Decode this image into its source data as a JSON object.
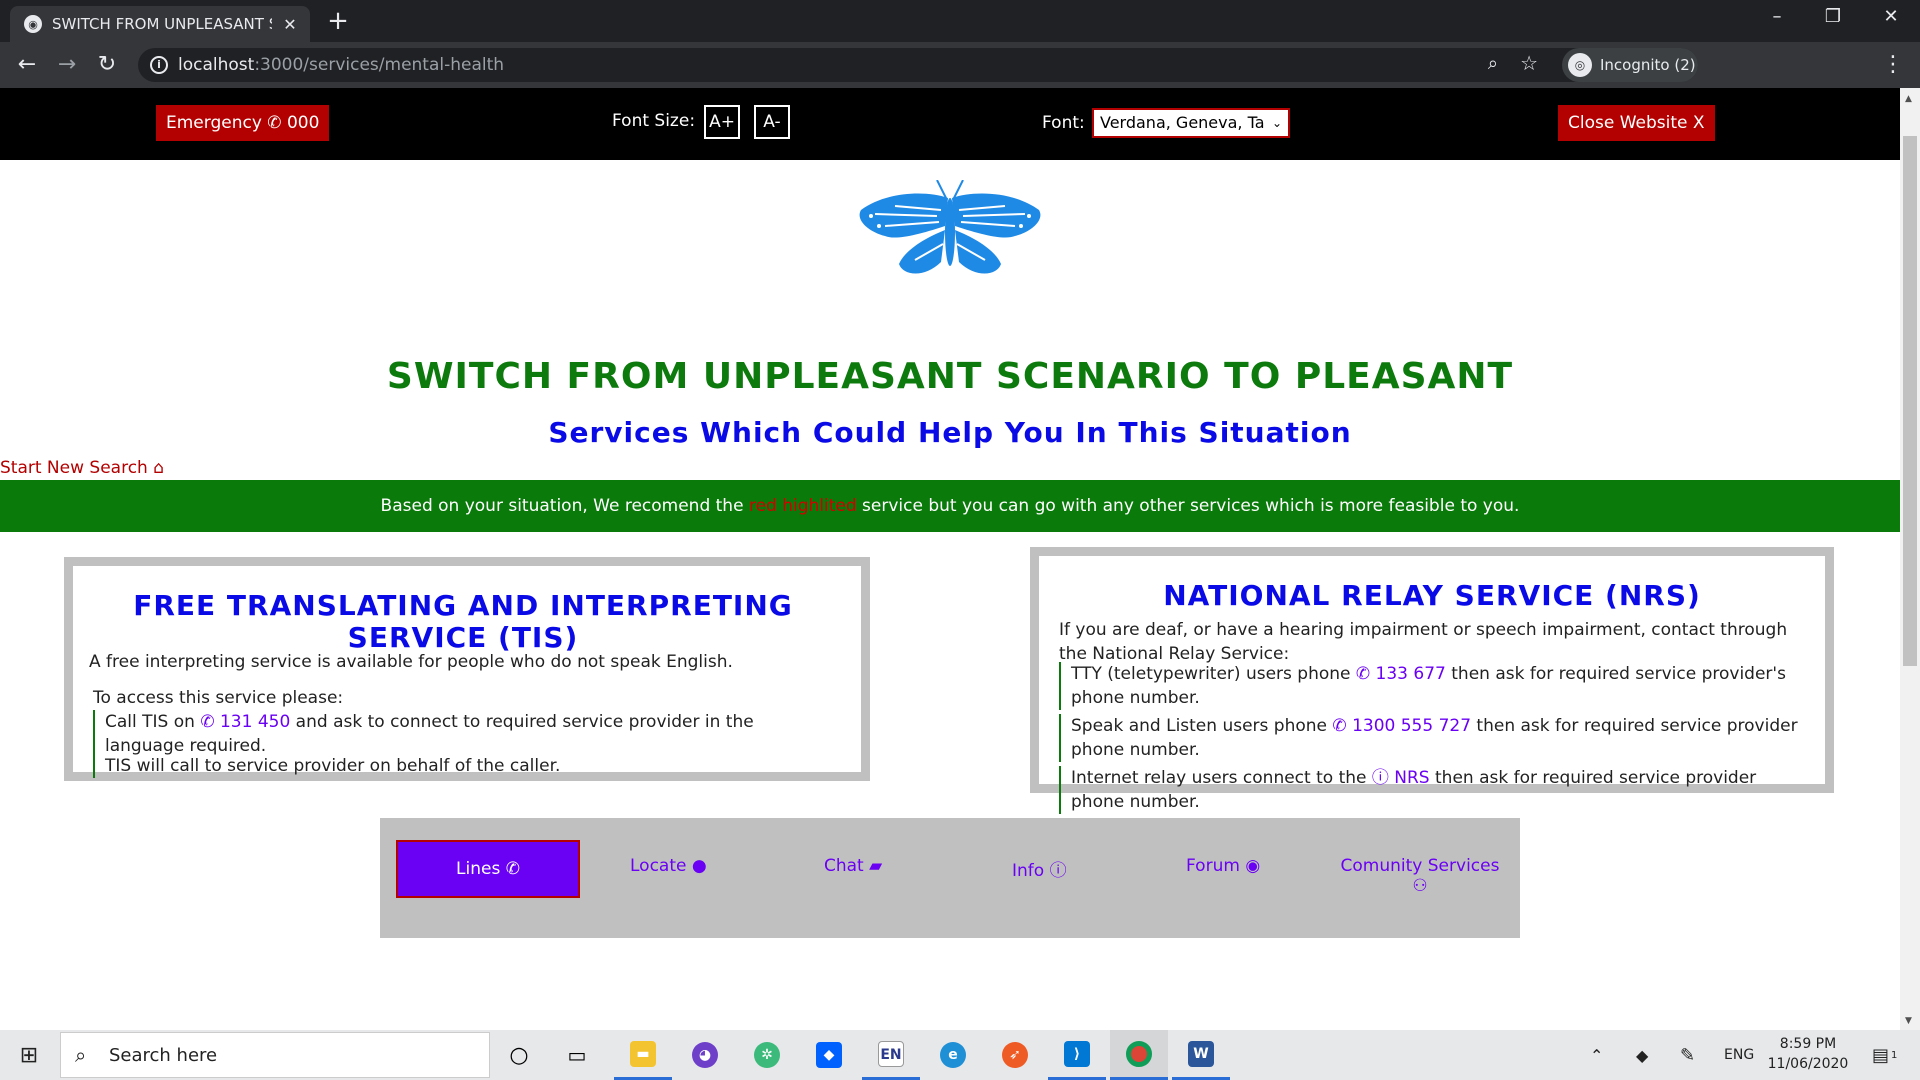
{
  "browser": {
    "tab_title": "SWITCH FROM UNPLEASANT SCENARIO TO PLEASANT",
    "url_host": "localhost",
    "url_path": ":3000/services/mental-health",
    "profile_label": "Incognito (2)"
  },
  "a11y": {
    "emergency_label": "Emergency",
    "emergency_number": "000",
    "font_size_label": "Font Size:",
    "font_increase": "A+",
    "font_decrease": "A-",
    "font_label": "Font:",
    "font_value": "Verdana, Geneva, Ta",
    "close_label": "Close Website X"
  },
  "header": {
    "title": "SWITCH FROM UNPLEASANT SCENARIO TO PLEASANT",
    "subtitle": "Services Which Could Help You In This Situation",
    "start_search": "Start New Search"
  },
  "banner": {
    "before": "Based on your situation, We recomend the ",
    "highlight": "red highlited",
    "after": " service but you can go with any other services which is more feasible to you."
  },
  "tis": {
    "title": "FREE TRANSLATING AND INTERPRETING SERVICE (TIS)",
    "intro": "A free interpreting service is available for people who do not speak English.",
    "access": "To access this service please:",
    "step1_pre": "Call TIS on ",
    "step1_phone": "131 450",
    "step1_post": " and ask to connect to required service provider in the language required.",
    "step2": "TIS will call to service provider on behalf of the caller."
  },
  "nrs": {
    "title": "NATIONAL RELAY SERVICE (NRS)",
    "intro": "If you are deaf, or have a hearing impairment or speech impairment, contact through the National Relay Service:",
    "tty_pre": "TTY (teletypewriter) users phone ",
    "tty_phone": "133 677",
    "tty_post": " then ask for required service provider's phone number.",
    "sal_pre": "Speak and Listen users phone ",
    "sal_phone": "1300 555 727",
    "sal_post": " then ask for required service provider phone number.",
    "irs_pre": "Internet relay users connect to the ",
    "irs_link": "NRS",
    "irs_post": " then ask for required service provider phone number."
  },
  "nav": {
    "lines": "Lines",
    "locate": "Locate",
    "chat": "Chat",
    "info": "Info",
    "forum": "Forum",
    "community": "Comunity Services"
  },
  "taskbar": {
    "search_placeholder": "Search here",
    "language": "ENG",
    "time": "8:59 PM",
    "date": "11/06/2020",
    "notification_count": "1"
  },
  "colors": {
    "title_green": "#0d7a0d",
    "heading_blue": "#0a0ae6",
    "link_purple": "#6a00f4",
    "alert_red": "#b30000",
    "butterfly_blue": "#1e8ae6"
  }
}
